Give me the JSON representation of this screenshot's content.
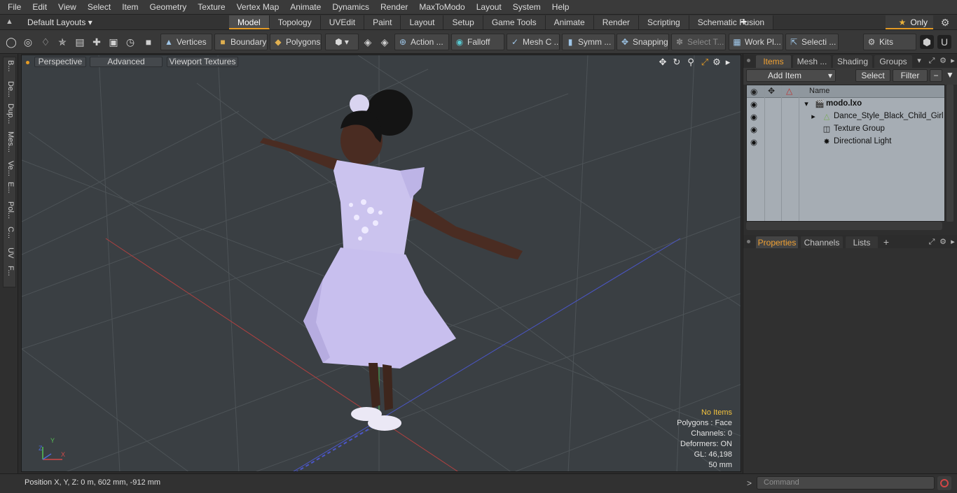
{
  "menu": [
    "File",
    "Edit",
    "View",
    "Select",
    "Item",
    "Geometry",
    "Texture",
    "Vertex Map",
    "Animate",
    "Dynamics",
    "Render",
    "MaxToModo",
    "Layout",
    "System",
    "Help"
  ],
  "layouts_label": "Default Layouts ▾",
  "tabs": [
    {
      "label": "Model",
      "active": true
    },
    {
      "label": "Topology"
    },
    {
      "label": "UVEdit"
    },
    {
      "label": "Paint"
    },
    {
      "label": "Layout"
    },
    {
      "label": "Setup"
    },
    {
      "label": "Game Tools"
    },
    {
      "label": "Animate"
    },
    {
      "label": "Render"
    },
    {
      "label": "Scripting"
    },
    {
      "label": "Schematic Fusion"
    }
  ],
  "tab_add": "+",
  "only_label": "Only",
  "toolbar": {
    "vertices": "Vertices",
    "boundary": "Boundary",
    "polygons": "Polygons",
    "action": "Action ...",
    "falloff": "Falloff",
    "mesh": "Mesh C ...",
    "symm": "Symm ...",
    "snapping": "Snapping",
    "select_t": "Select T...",
    "workpl": "Work Pl...",
    "selecti": "Selecti ...",
    "kits": "Kits"
  },
  "left_tabs": [
    "B...",
    "De...",
    "Dup...",
    "Mes...",
    "Ve...",
    "E...",
    "Pol...",
    "C...",
    "UV",
    "F..."
  ],
  "viewport": {
    "perspective": "Perspective",
    "advanced": "Advanced",
    "textures": "Viewport Textures",
    "hud": {
      "no_items": "No Items",
      "polygons": "Polygons : Face",
      "channels": "Channels: 0",
      "deformers": "Deformers: ON",
      "gl": "GL: 46,198",
      "scale": "50 mm"
    },
    "axes": {
      "x": "X",
      "y": "Y",
      "z": "Z"
    }
  },
  "status": {
    "position": "Position X, Y, Z:   0 m, 602 mm, -912 mm",
    "command_placeholder": "Command",
    "caret": ">"
  },
  "panel": {
    "tabs_top": [
      "Items",
      "Mesh ...",
      "Shading",
      "Groups"
    ],
    "add_item": "Add Item",
    "select": "Select",
    "filter": "Filter",
    "name_header": "Name",
    "tree": [
      {
        "label": "modo.lxo",
        "bold": true
      },
      {
        "label": "Dance_Style_Black_Child_Girl ..."
      },
      {
        "label": "Texture Group"
      },
      {
        "label": "Directional Light"
      }
    ],
    "tabs_bottom": [
      "Properties",
      "Channels",
      "Lists"
    ],
    "add": "+"
  },
  "colors": {
    "accent": "#e59b24",
    "viewport_bg": "#3a3f43",
    "tree_bg": "#a6adb4"
  }
}
